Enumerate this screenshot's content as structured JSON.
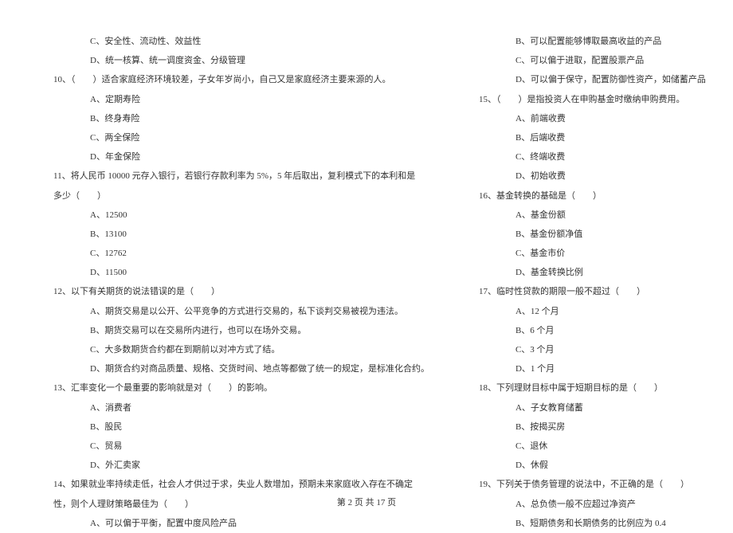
{
  "left": [
    {
      "cls": "indent-opt",
      "t": "C、安全性、流动性、效益性"
    },
    {
      "cls": "indent-opt",
      "t": "D、统一核算、统一调度资金、分级管理"
    },
    {
      "cls": "indent-q",
      "t": "10、（　　）适合家庭经济环境较差，子女年岁尚小，自己又是家庭经济主要来源的人。"
    },
    {
      "cls": "indent-opt",
      "t": "A、定期寿险"
    },
    {
      "cls": "indent-opt",
      "t": "B、终身寿险"
    },
    {
      "cls": "indent-opt",
      "t": "C、两全保险"
    },
    {
      "cls": "indent-opt",
      "t": "D、年金保险"
    },
    {
      "cls": "indent-q",
      "t": "11、将人民币 10000 元存入银行，若银行存款利率为 5%，5 年后取出，复利模式下的本利和是"
    },
    {
      "cls": "indent-cont",
      "t": "多少（　　）"
    },
    {
      "cls": "indent-opt",
      "t": "A、12500"
    },
    {
      "cls": "indent-opt",
      "t": "B、13100"
    },
    {
      "cls": "indent-opt",
      "t": "C、12762"
    },
    {
      "cls": "indent-opt",
      "t": "D、11500"
    },
    {
      "cls": "indent-q",
      "t": "12、以下有关期货的说法错误的是（　　）"
    },
    {
      "cls": "indent-opt",
      "t": "A、期货交易是以公开、公平竞争的方式进行交易的，私下谈判交易被视为违法。"
    },
    {
      "cls": "indent-opt",
      "t": "B、期货交易可以在交易所内进行，也可以在场外交易。"
    },
    {
      "cls": "indent-opt",
      "t": "C、大多数期货合约都在到期前以对冲方式了结。"
    },
    {
      "cls": "indent-opt",
      "t": "D、期货合约对商品质量、规格、交货时间、地点等都做了统一的规定，是标准化合约。"
    },
    {
      "cls": "indent-q",
      "t": "13、汇率变化一个最重要的影响就是对（　　）的影响。"
    },
    {
      "cls": "indent-opt",
      "t": "A、消费者"
    },
    {
      "cls": "indent-opt",
      "t": "B、股民"
    },
    {
      "cls": "indent-opt",
      "t": "C、贸易"
    },
    {
      "cls": "indent-opt",
      "t": "D、外汇卖家"
    },
    {
      "cls": "indent-q",
      "t": "14、如果就业率持续走低，社会人才供过于求，失业人数增加，预期未来家庭收入存在不确定"
    },
    {
      "cls": "indent-cont",
      "t": "性，则个人理财策略最佳为（　　）"
    },
    {
      "cls": "indent-opt",
      "t": "A、可以偏于平衡，配置中度风险产品"
    }
  ],
  "right": [
    {
      "cls": "indent-opt",
      "t": "B、可以配置能够博取最高收益的产品"
    },
    {
      "cls": "indent-opt",
      "t": "C、可以偏于进取，配置股票产品"
    },
    {
      "cls": "indent-opt",
      "t": "D、可以偏于保守，配置防御性资产，如储蓄产品"
    },
    {
      "cls": "indent-q",
      "t": "15、（　　）是指投资人在申购基金时缴纳申购费用。"
    },
    {
      "cls": "indent-opt",
      "t": "A、前端收费"
    },
    {
      "cls": "indent-opt",
      "t": "B、后端收费"
    },
    {
      "cls": "indent-opt",
      "t": "C、终端收费"
    },
    {
      "cls": "indent-opt",
      "t": "D、初始收费"
    },
    {
      "cls": "indent-q",
      "t": "16、基金转换的基础是（　　）"
    },
    {
      "cls": "indent-opt",
      "t": "A、基金份额"
    },
    {
      "cls": "indent-opt",
      "t": "B、基金份额净值"
    },
    {
      "cls": "indent-opt",
      "t": "C、基金市价"
    },
    {
      "cls": "indent-opt",
      "t": "D、基金转换比例"
    },
    {
      "cls": "indent-q",
      "t": "17、临时性贷款的期限一般不超过（　　）"
    },
    {
      "cls": "indent-opt",
      "t": "A、12 个月"
    },
    {
      "cls": "indent-opt",
      "t": "B、6 个月"
    },
    {
      "cls": "indent-opt",
      "t": "C、3 个月"
    },
    {
      "cls": "indent-opt",
      "t": "D、1 个月"
    },
    {
      "cls": "indent-q",
      "t": "18、下列理财目标中属于短期目标的是（　　）"
    },
    {
      "cls": "indent-opt",
      "t": "A、子女教育储蓄"
    },
    {
      "cls": "indent-opt",
      "t": "B、按揭买房"
    },
    {
      "cls": "indent-opt",
      "t": "C、退休"
    },
    {
      "cls": "indent-opt",
      "t": "D、休假"
    },
    {
      "cls": "indent-q",
      "t": "19、下列关于债务管理的说法中，不正确的是（　　）"
    },
    {
      "cls": "indent-opt",
      "t": "A、总负债一般不应超过净资产"
    },
    {
      "cls": "indent-opt",
      "t": "B、短期债务和长期债务的比例应为 0.4"
    }
  ],
  "footer": "第 2 页 共 17 页"
}
